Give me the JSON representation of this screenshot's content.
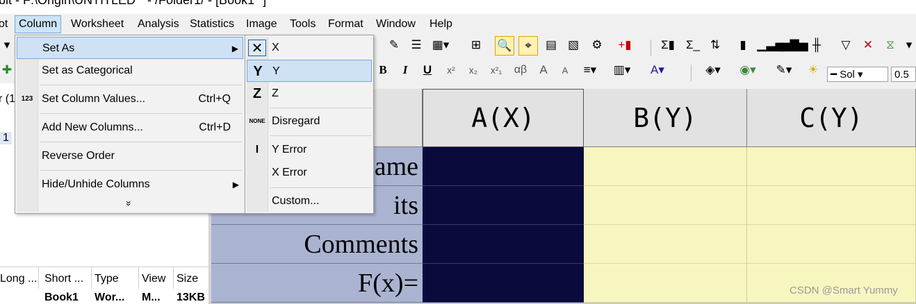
{
  "window": {
    "title": "bit - F:\\Origin\\UNTITLED * - /Folder1/ - [Book1 *]"
  },
  "menubar": {
    "items": [
      "ot",
      "Column",
      "Worksheet",
      "Analysis",
      "Statistics",
      "Image",
      "Tools",
      "Format",
      "Window",
      "Help"
    ]
  },
  "toolbar": {
    "format": {
      "bold": "B",
      "italic": "I",
      "underline": "U",
      "superscript": "x²",
      "subscript": "x₂",
      "supsub": "x²₁",
      "greek": "αβ",
      "font_color": "A",
      "line_style": "Sol",
      "line_width": "0.5"
    },
    "stats": {
      "sigma_col": "Σ",
      "sigma_row": "Σ"
    }
  },
  "left_panel": {
    "tree_label": "r (1",
    "tree_num": "1",
    "columns": [
      "Long ...",
      "Short ...",
      "Type",
      "View",
      "Size"
    ],
    "row": [
      "",
      "Book1",
      "Wor...",
      "M...",
      "13KB"
    ]
  },
  "worksheet": {
    "columns": [
      "A(X)",
      "B(Y)",
      "C(Y)"
    ],
    "row_labels": [
      "ame",
      "its",
      "Comments",
      "F(x)="
    ]
  },
  "column_menu": {
    "items": [
      {
        "label": "Set As",
        "shortcut": "",
        "submenu": true
      },
      {
        "label": "Set as Categorical",
        "shortcut": ""
      },
      {
        "label": "Set Column Values...",
        "shortcut": "Ctrl+Q",
        "icon": "123"
      },
      {
        "label": "Add New Columns...",
        "shortcut": "Ctrl+D"
      },
      {
        "label": "Reverse Order",
        "shortcut": ""
      },
      {
        "label": "Hide/Unhide Columns",
        "shortcut": "",
        "submenu": true
      }
    ],
    "expand_icon": "»"
  },
  "set_as_submenu": {
    "items": [
      {
        "label": "X",
        "icon": "X"
      },
      {
        "label": "Y",
        "icon": "Y"
      },
      {
        "label": "Z",
        "icon": "Z"
      },
      {
        "label": "Disregard",
        "icon": "NONE"
      },
      {
        "label": "Y Error",
        "icon": "I"
      },
      {
        "label": "X Error",
        "icon": ""
      },
      {
        "label": "Custom...",
        "icon": ""
      }
    ]
  },
  "watermark": "CSDN @Smart Yummy",
  "colors": {
    "accent": "#cce4f7",
    "column_a": "#0a0a3c",
    "column_y": "#f7f6bf",
    "label_bg": "#aab4d1"
  }
}
